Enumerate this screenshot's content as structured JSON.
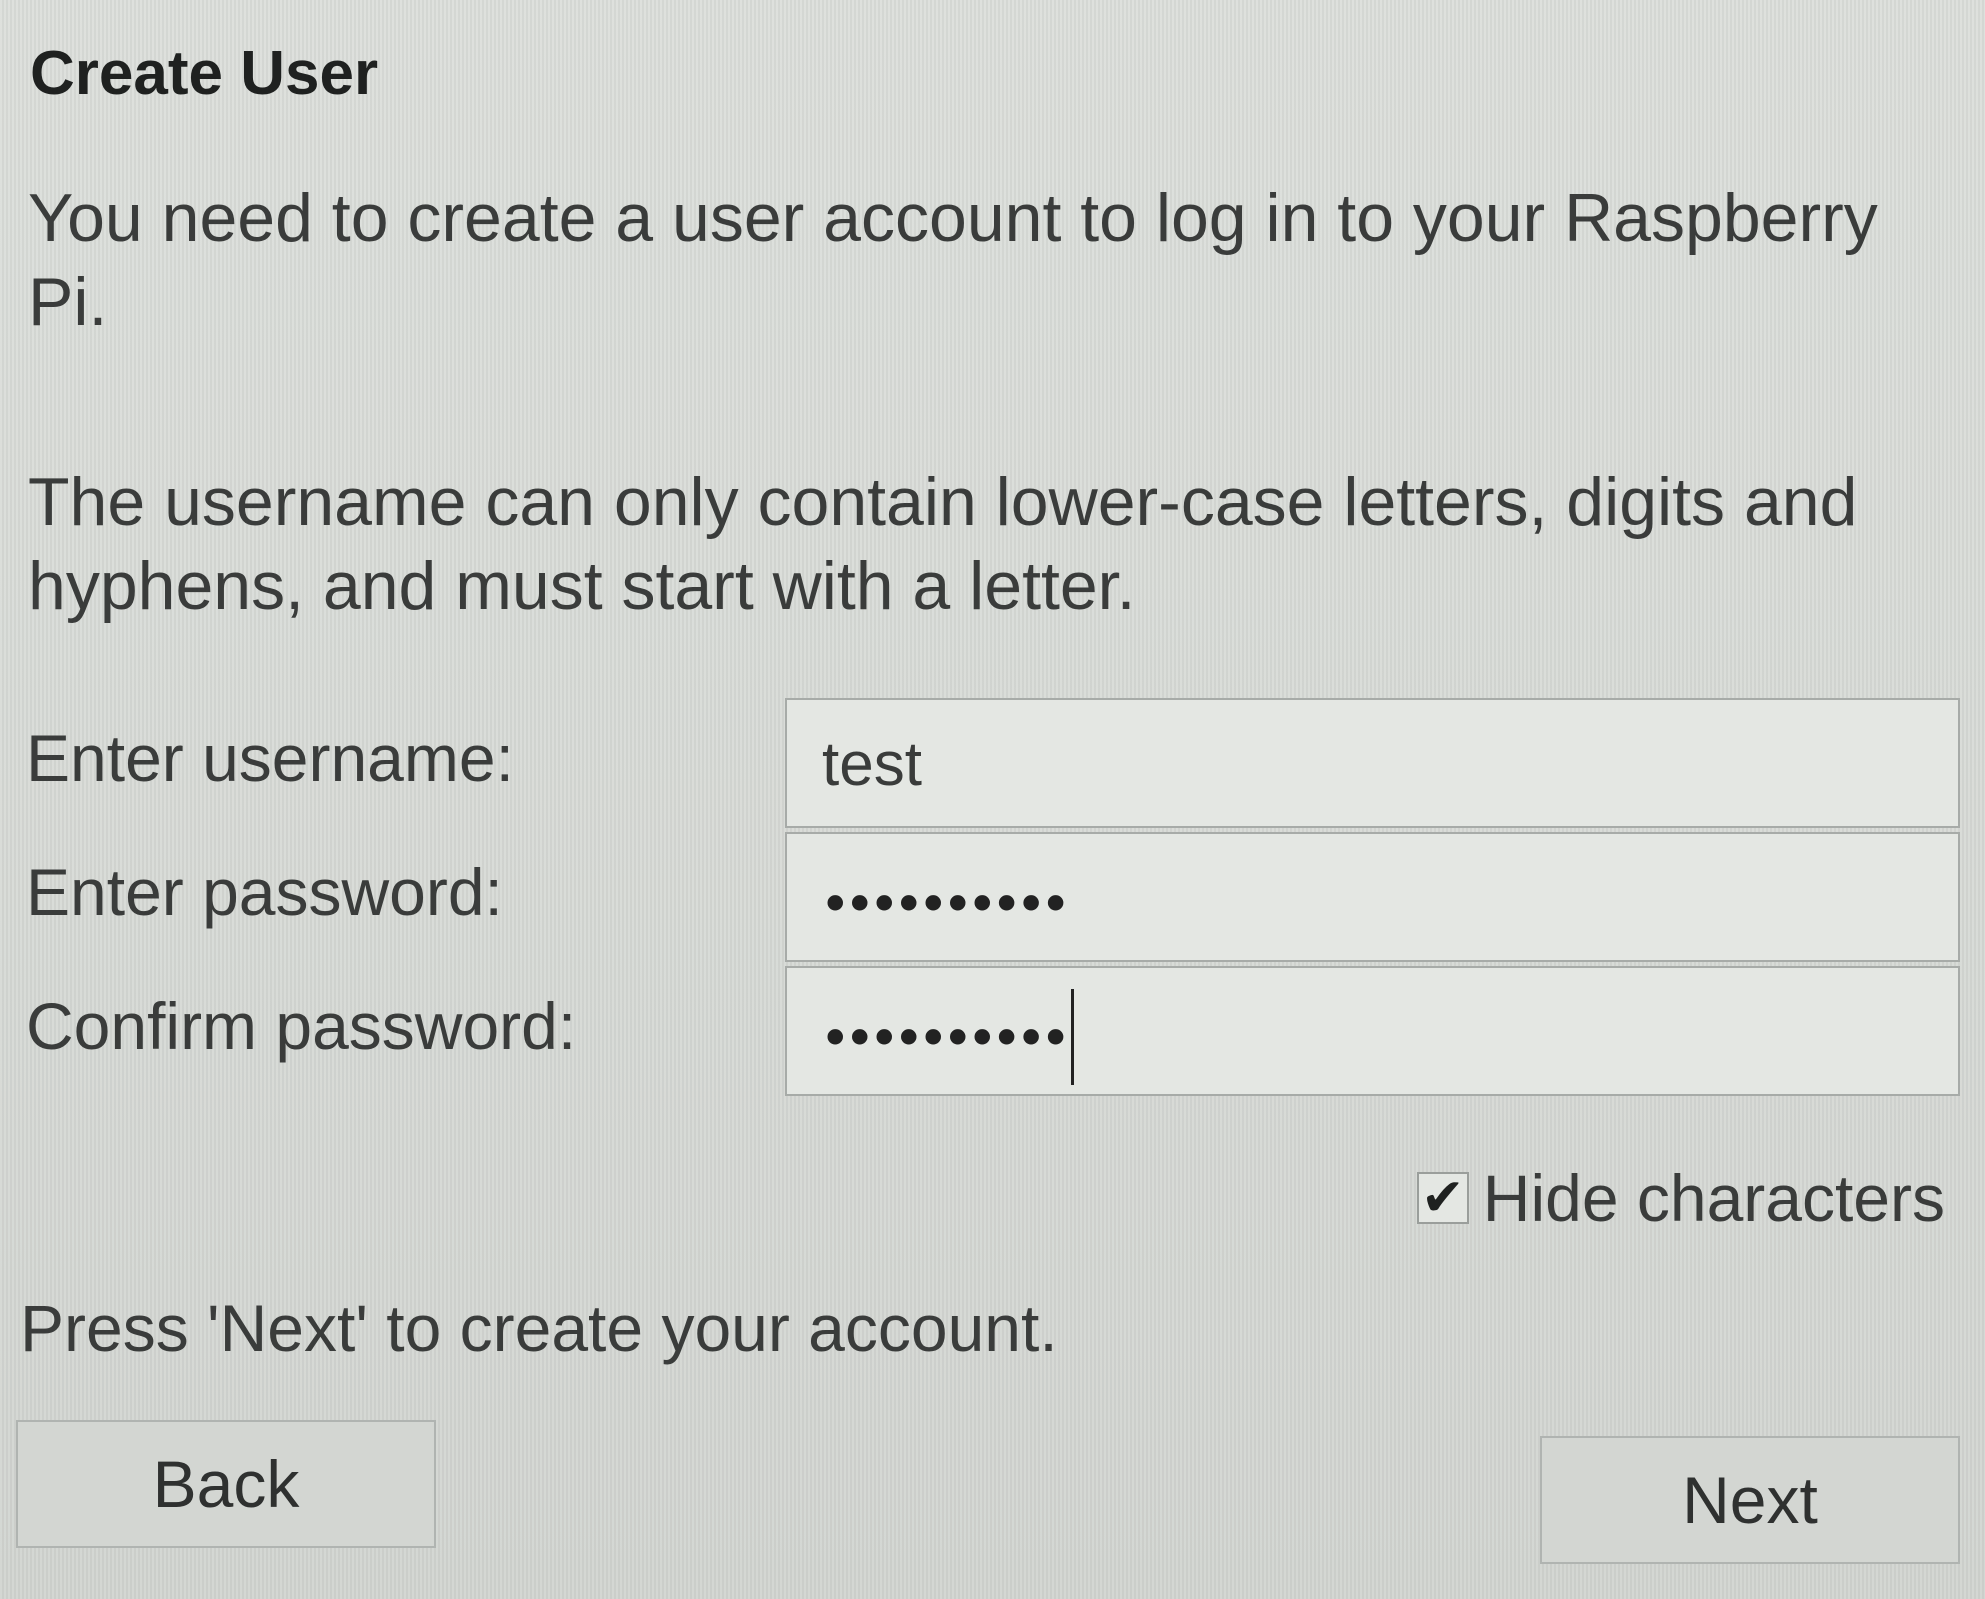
{
  "dialog": {
    "title": "Create User",
    "intro": "You need to create a user account to log in to your Raspberry Pi.",
    "rules": "The username can only contain lower-case letters, digits and hyphens, and must start with a letter.",
    "instruction": "Press 'Next' to create your account."
  },
  "form": {
    "username_label": "Enter username:",
    "username_value": "test",
    "password_label": "Enter password:",
    "password_masked": "••••••••••",
    "confirm_label": "Confirm password:",
    "confirm_masked": "••••••••••",
    "hide_characters_label": "Hide characters",
    "hide_characters_checked": true
  },
  "buttons": {
    "back": "Back",
    "next": "Next"
  }
}
